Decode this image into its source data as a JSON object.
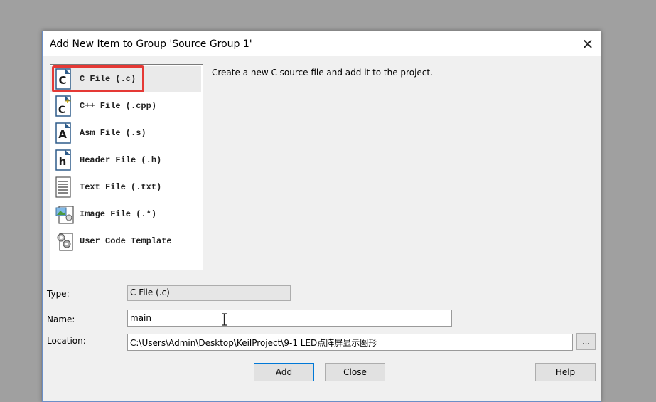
{
  "dialog": {
    "title": "Add New Item to Group 'Source Group 1'",
    "close_glyph": "✕"
  },
  "file_types": [
    {
      "label": "C File (.c)",
      "icon": "c-file-icon",
      "glyph": "C",
      "selected": true
    },
    {
      "label": "C++ File (.cpp)",
      "icon": "cpp-file-icon",
      "glyph": "C",
      "selected": false
    },
    {
      "label": "Asm File (.s)",
      "icon": "asm-file-icon",
      "glyph": "A",
      "selected": false
    },
    {
      "label": "Header File (.h)",
      "icon": "header-file-icon",
      "glyph": "h",
      "selected": false
    },
    {
      "label": "Text File (.txt)",
      "icon": "text-file-icon",
      "glyph": "",
      "selected": false
    },
    {
      "label": "Image File (.*)",
      "icon": "image-file-icon",
      "glyph": "",
      "selected": false
    },
    {
      "label": "User Code Template",
      "icon": "user-code-template-icon",
      "glyph": "",
      "selected": false
    }
  ],
  "description": "Create a new C source file and add it to the project.",
  "form": {
    "type_label": "Type:",
    "type_value": "C File (.c)",
    "name_label": "Name:",
    "name_value": "main",
    "location_label": "Location:",
    "location_value": "C:\\Users\\Admin\\Desktop\\KeilProject\\9-1 LED点阵屏显示图形",
    "browse_label": "..."
  },
  "buttons": {
    "add": "Add",
    "close": "Close",
    "help": "Help"
  },
  "colors": {
    "highlight": "#e53935",
    "dialog_border": "#6b8fc7",
    "background": "#a0a0a0"
  }
}
